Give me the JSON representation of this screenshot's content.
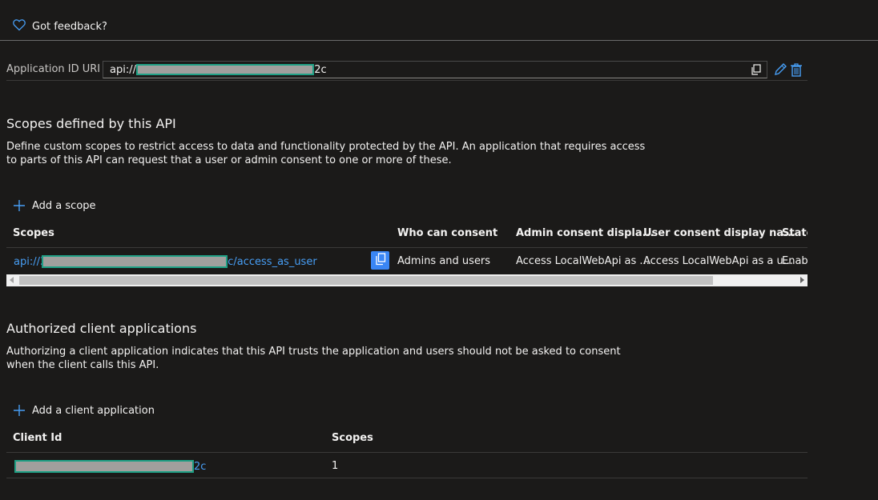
{
  "feedback": {
    "label": "Got feedback?"
  },
  "app_id_uri": {
    "label": "Application ID URI",
    "value_prefix": "api://3",
    "value_suffix": "2c"
  },
  "scopes_section": {
    "title": "Scopes defined by this API",
    "description": "Define custom scopes to restrict access to data and functionality protected by the API. An application that requires access to parts of this API can request that a user or admin consent to one or more of these.",
    "add_label": "Add a scope",
    "columns": [
      "Scopes",
      "Who can consent",
      "Admin consent displa...",
      "User consent display na...",
      "State"
    ],
    "rows": [
      {
        "scope_prefix": "api://3",
        "scope_suffix": "c/access_as_user",
        "who_can_consent": "Admins and users",
        "admin_consent_display": "Access LocalWebApi as ...",
        "user_consent_display": "Access LocalWebApi as a u...",
        "state": "Enabl"
      }
    ]
  },
  "clients_section": {
    "title": "Authorized client applications",
    "description": "Authorizing a client application indicates that this API trusts the application and users should not be asked to consent when the client calls this API.",
    "add_label": "Add a client application",
    "columns": [
      "Client Id",
      "Scopes"
    ],
    "rows": [
      {
        "client_id_suffix": "2c",
        "scopes": "1"
      }
    ]
  },
  "colors": {
    "background": "#1b1a19",
    "link": "#479ef5",
    "accent": "#3a86f4",
    "redaction_border": "#1fa085"
  }
}
